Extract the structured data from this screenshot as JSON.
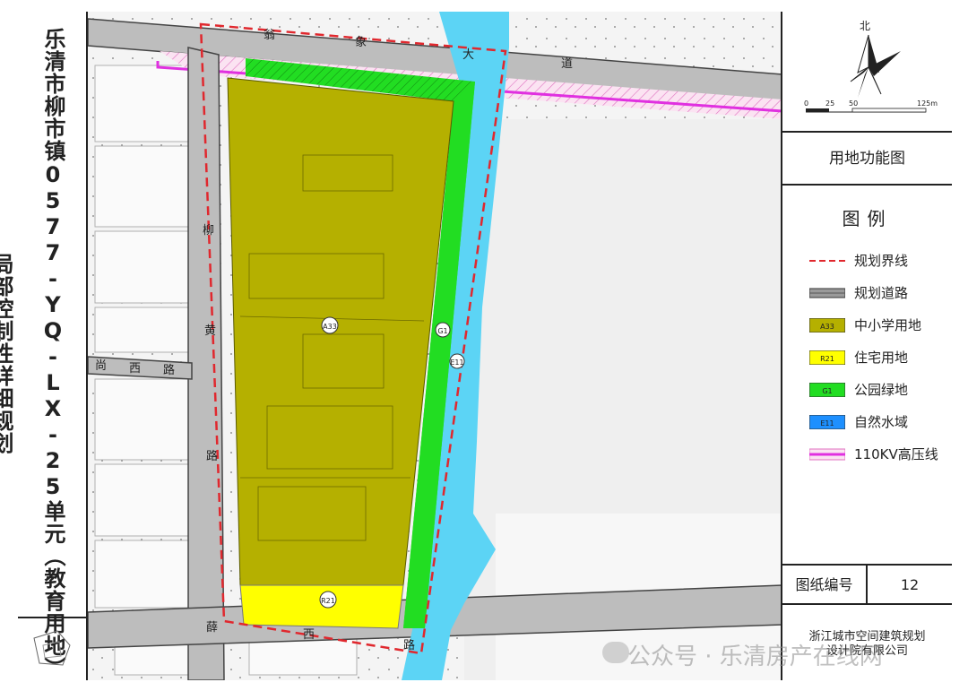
{
  "title": "乐清市柳市镇0577-YQ-LX-25单元（教育用地）局部控制性详细规划",
  "north_label": "北",
  "scale": {
    "ticks": [
      "0",
      "25",
      "50",
      "125m"
    ]
  },
  "map_title": "用地功能图",
  "legend": {
    "heading": "图例",
    "items": [
      {
        "label": "规划界线",
        "swatch": "dashed-red",
        "color": "#e0282e"
      },
      {
        "label": "规划道路",
        "swatch": "road",
        "color": "#9a9a9a"
      },
      {
        "label": "中小学用地",
        "swatch": "fill",
        "code": "A33",
        "color": "#b5b000"
      },
      {
        "label": "住宅用地",
        "swatch": "fill",
        "code": "R21",
        "color": "#ffff00"
      },
      {
        "label": "公园绿地",
        "swatch": "fill",
        "code": "G1",
        "color": "#22dd22"
      },
      {
        "label": "自然水域",
        "swatch": "fill",
        "code": "E11",
        "color": "#1e90ff"
      },
      {
        "label": "110KV高压线",
        "swatch": "powerline",
        "color": "#e030e0"
      }
    ]
  },
  "sheet": {
    "label": "图纸编号",
    "value": "12"
  },
  "organization": {
    "line1": "浙江城市空间建筑规划",
    "line2": "设计院有限公司"
  },
  "roads": {
    "north": [
      "翁",
      "象",
      "大",
      "道"
    ],
    "west": [
      "柳",
      "黄",
      "路"
    ],
    "cross_west": [
      "尚",
      "西",
      "路"
    ],
    "south": [
      "薛",
      "西",
      "路"
    ]
  },
  "parcel_codes": {
    "school": "A33",
    "residential": "R21",
    "green": "G1",
    "water": "E11"
  },
  "watermark": "公众号 · 乐清房产在线网",
  "colors": {
    "school": "#b5b000",
    "residential": "#ffff00",
    "green": "#22dd22",
    "water": "#5cd4f5",
    "road": "#8c8c8c",
    "boundary": "#e0282e",
    "powerline": "#e030e0"
  }
}
